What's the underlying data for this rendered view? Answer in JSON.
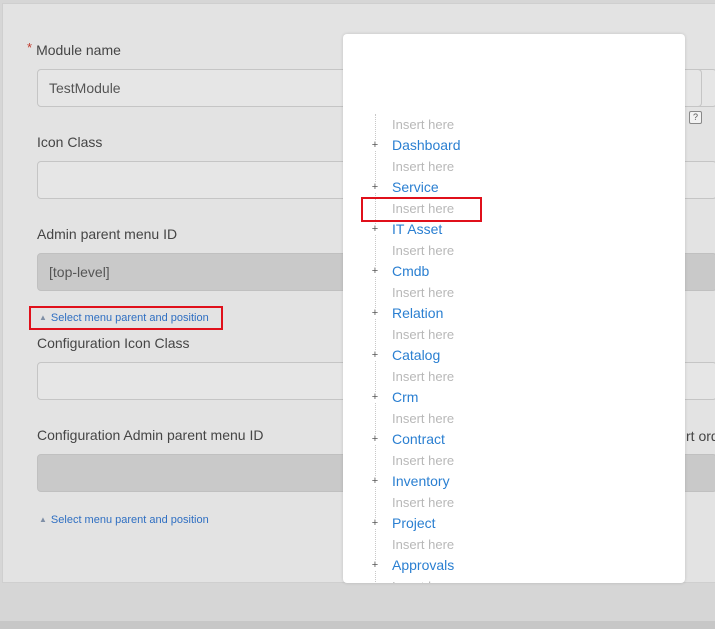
{
  "form": {
    "required_mark": "*",
    "module_name_label": "Module name",
    "module_name_value": "TestModule",
    "icon_class_label": "Icon Class",
    "icon_class_value": "",
    "admin_parent_label": "Admin parent menu ID",
    "admin_parent_value": "[top-level]",
    "select_menu_link": "Select menu parent and position",
    "config_icon_label": "Configuration Icon Class",
    "config_icon_value": "",
    "config_admin_parent_label": "Configuration Admin parent menu ID",
    "config_admin_parent_value": "",
    "select_menu_link_2": "Select menu parent and position",
    "sort_order_partial": "rt ord",
    "help_glyph": "?"
  },
  "popup": {
    "insert_label": "Insert here",
    "toggle_glyph": "+",
    "items": [
      {
        "kind": "insert",
        "label": "Insert here"
      },
      {
        "kind": "node",
        "label": "Dashboard"
      },
      {
        "kind": "insert",
        "label": "Insert here"
      },
      {
        "kind": "node",
        "label": "Service"
      },
      {
        "kind": "insert",
        "label": "Insert here",
        "highlighted": true
      },
      {
        "kind": "node",
        "label": "IT Asset"
      },
      {
        "kind": "insert",
        "label": "Insert here"
      },
      {
        "kind": "node",
        "label": "Cmdb"
      },
      {
        "kind": "insert",
        "label": "Insert here"
      },
      {
        "kind": "node",
        "label": "Relation"
      },
      {
        "kind": "insert",
        "label": "Insert here"
      },
      {
        "kind": "node",
        "label": "Catalog"
      },
      {
        "kind": "insert",
        "label": "Insert here"
      },
      {
        "kind": "node",
        "label": "Crm"
      },
      {
        "kind": "insert",
        "label": "Insert here"
      },
      {
        "kind": "node",
        "label": "Contract"
      },
      {
        "kind": "insert",
        "label": "Insert here"
      },
      {
        "kind": "node",
        "label": "Inventory"
      },
      {
        "kind": "insert",
        "label": "Insert here"
      },
      {
        "kind": "node",
        "label": "Project"
      },
      {
        "kind": "insert",
        "label": "Insert here"
      },
      {
        "kind": "node",
        "label": "Approvals"
      },
      {
        "kind": "insert",
        "label": "Insert here"
      }
    ]
  },
  "colors": {
    "link": "#2f6fc2",
    "tree_node": "#2a7fd1",
    "highlight": "#e0101b",
    "insert_text": "#b8b8b8"
  }
}
